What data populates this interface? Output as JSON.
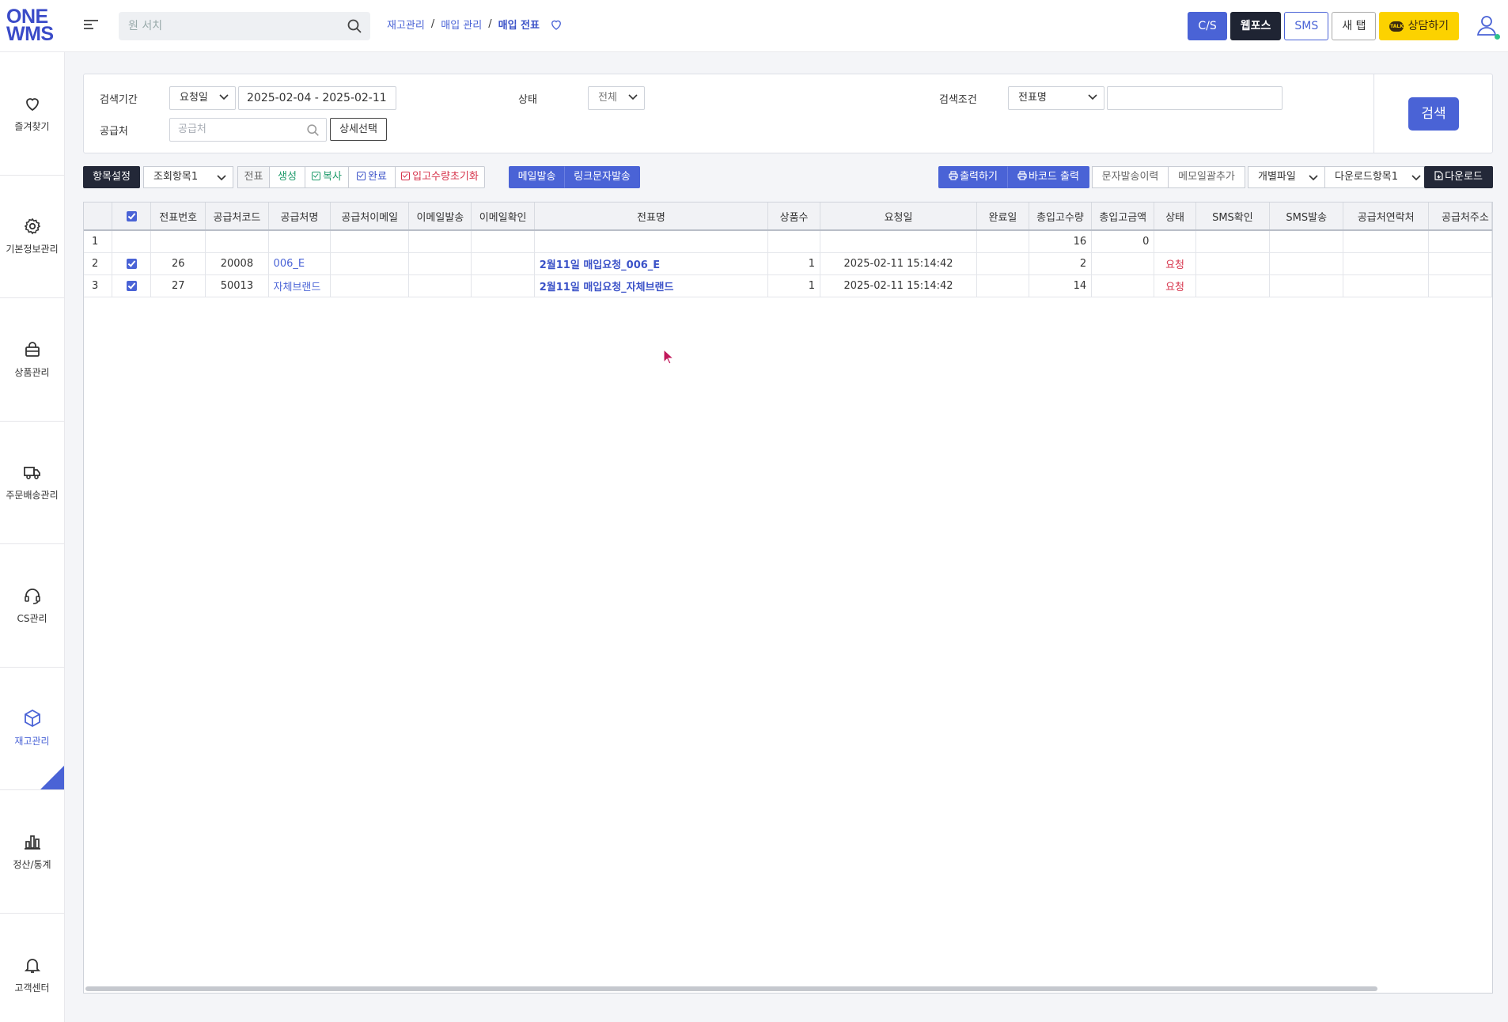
{
  "logo": {
    "line1": "ONE",
    "line2": "WMS"
  },
  "top_search": {
    "placeholder": "원 서치"
  },
  "breadcrumb": {
    "items": [
      "재고관리",
      "매입 관리"
    ],
    "current": "매입 전표"
  },
  "top_buttons": {
    "cs": "C/S",
    "webpos": "웹포스",
    "sms": "SMS",
    "newtab": "새 탭",
    "consult": "상담하기",
    "talk_badge": "TALK"
  },
  "sidebar": [
    {
      "label": "즐겨찾기",
      "icon": "heart-icon"
    },
    {
      "label": "기본정보관리",
      "icon": "gear-icon"
    },
    {
      "label": "상품관리",
      "icon": "bag-icon"
    },
    {
      "label": "주문배송관리",
      "icon": "truck-icon"
    },
    {
      "label": "CS관리",
      "icon": "headset-icon"
    },
    {
      "label": "재고관리",
      "icon": "box-icon",
      "active": true
    },
    {
      "label": "정산/통계",
      "icon": "bar-chart-icon"
    },
    {
      "label": "고객센터",
      "icon": "bell-icon"
    }
  ],
  "filters": {
    "period_label": "검색기간",
    "period_type": "요청일",
    "period_range": "2025-02-04 - 2025-02-11",
    "status_label": "상태",
    "status_value": "전체",
    "condition_label": "검색조건",
    "condition_value": "전표명",
    "condition_input": "",
    "supplier_label": "공급처",
    "supplier_placeholder": "공급처",
    "detail_button": "상세선택",
    "search_button": "검색"
  },
  "toolbar": {
    "column_settings": "항목설정",
    "view_item": "조회항목1",
    "jeonpyo": "전표",
    "create": "생성",
    "copy": "복사",
    "complete": "완료",
    "reset_qty": "입고수량초기화",
    "send_mail": "메일발송",
    "send_link_sms": "링크문자발송",
    "print": "출력하기",
    "barcode_print": "바코드 출력",
    "sms_history": "문자발송이력",
    "memo_add": "메모일괄추가",
    "individual_file": "개별파일",
    "download_item": "다운로드항목1",
    "download": "다운로드"
  },
  "grid": {
    "columns": [
      "",
      "",
      "전표번호",
      "공급처코드",
      "공급처명",
      "공급처이메일",
      "이메일발송",
      "이메일확인",
      "전표명",
      "상품수",
      "요청일",
      "완료일",
      "총입고수량",
      "총입고금액",
      "상태",
      "SMS확인",
      "SMS발송",
      "공급처연락처",
      "공급처주소"
    ],
    "summary": {
      "row": "1",
      "total_qty": "16",
      "total_amount": "0"
    },
    "rows": [
      {
        "row": "2",
        "checked": true,
        "slip_no": "26",
        "supplier_code": "20008",
        "supplier_name": "006_E",
        "supplier_email": "",
        "email_sent": "",
        "email_checked": "",
        "slip_name": "2월11일 매입요청_006_E",
        "product_count": "1",
        "request_date": "2025-02-11 15:14:42",
        "complete_date": "",
        "total_qty": "2",
        "total_amount": "",
        "status": "요청",
        "sms_check": "",
        "sms_send": "",
        "supplier_contact": "",
        "supplier_address": ""
      },
      {
        "row": "3",
        "checked": true,
        "slip_no": "27",
        "supplier_code": "50013",
        "supplier_name": "자체브랜드",
        "supplier_email": "",
        "email_sent": "",
        "email_checked": "",
        "slip_name": "2월11일 매입요청_자체브랜드",
        "product_count": "1",
        "request_date": "2025-02-11 15:14:42",
        "complete_date": "",
        "total_qty": "14",
        "total_amount": "",
        "status": "요청",
        "sms_check": "",
        "sms_send": "",
        "supplier_contact": "",
        "supplier_address": ""
      }
    ]
  },
  "colors": {
    "accent": "#4a63d6",
    "dark": "#232838",
    "status_red": "#d6334b",
    "consult_yellow": "#fcd200"
  }
}
